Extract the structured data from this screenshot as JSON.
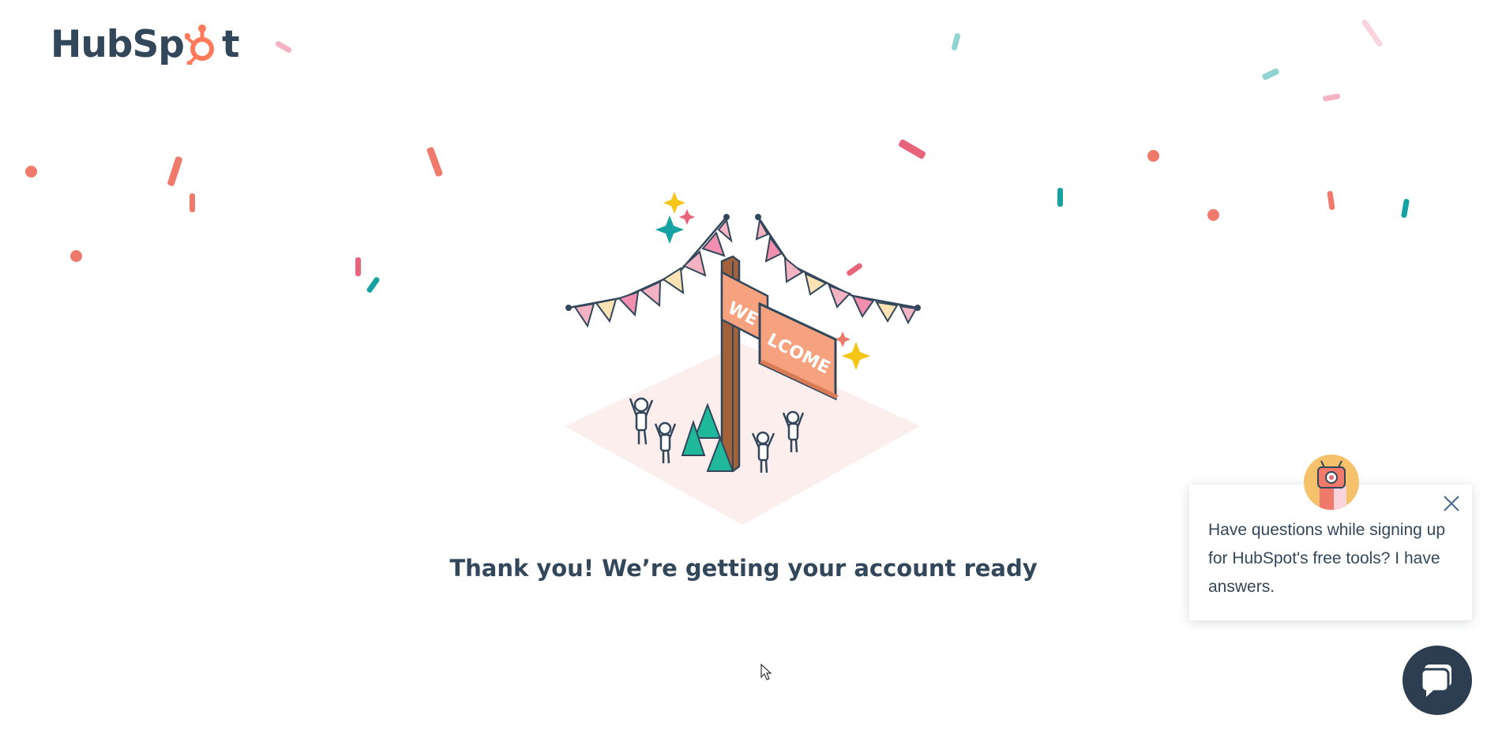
{
  "brand": {
    "logo_text_left": "HubSp",
    "logo_text_right": "t",
    "accent": "#ff7a59",
    "text_color": "#33475b"
  },
  "illustration": {
    "sign_top": "WE",
    "sign_bottom": "LCOME"
  },
  "headline": "Thank you! We’re getting your account ready",
  "chat": {
    "message": "Have questions while signing up for HubSpot's free tools? I have answers.",
    "close_icon": "close-icon",
    "launcher_icon": "chat-bubble-icon",
    "launcher_color": "#2d3e50"
  },
  "confetti_colors": [
    "#f28b82",
    "#e8647a",
    "#17a2a2",
    "#ef7a6b",
    "#f4b3c2",
    "#8fd3d3"
  ]
}
